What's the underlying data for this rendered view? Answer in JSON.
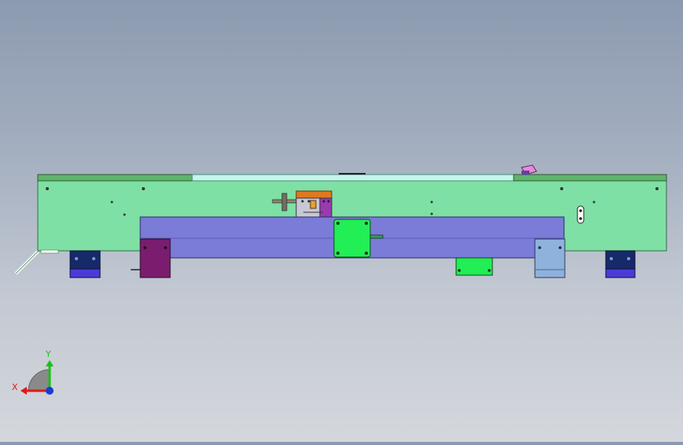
{
  "viewport": {
    "background_top": "#8c9ab0",
    "background_bottom": "#d4d7dc"
  },
  "model": {
    "frame_color": "#7ee0a4",
    "top_rail_color": "#5db56a",
    "glass_strip_color": "#c4f6ea",
    "carriage_color": "#7b7bd8",
    "motor_color": "#22ee55",
    "left_block_color": "#7a1d6e",
    "right_block_color": "#8fb2dc",
    "foot_color": "#4a3bd8",
    "foot_top_color": "#162a6a",
    "orange_bracket_color": "#e0781e",
    "pink_part_color": "#e98ad8"
  },
  "triad": {
    "x_label": "X",
    "y_label": "Y",
    "x_color": "#e01818",
    "y_color": "#18c018",
    "z_color": "#1a3bd8"
  }
}
